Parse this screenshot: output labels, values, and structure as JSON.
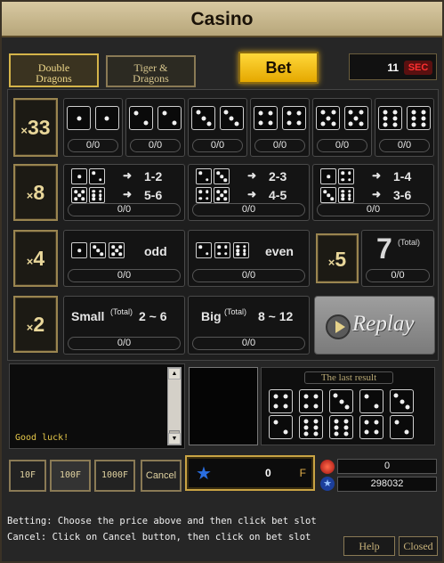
{
  "window": {
    "title": "Casino"
  },
  "tabs": [
    {
      "label": "Double Dragons",
      "active": true
    },
    {
      "label": "Tiger & Dragons",
      "active": false
    }
  ],
  "bet_button": "Bet",
  "counter": {
    "value": "11",
    "unit": "SEC"
  },
  "multipliers": [
    {
      "x": "×",
      "v": "33"
    },
    {
      "x": "×",
      "v": "8"
    },
    {
      "x": "×",
      "v": "4"
    },
    {
      "x": "×",
      "v": "2"
    },
    {
      "x": "×",
      "v": "5"
    }
  ],
  "doubles": [
    {
      "faces": [
        1,
        1
      ],
      "count": "0/0"
    },
    {
      "faces": [
        2,
        2
      ],
      "count": "0/0"
    },
    {
      "faces": [
        3,
        3
      ],
      "count": "0/0"
    },
    {
      "faces": [
        4,
        4
      ],
      "count": "0/0"
    },
    {
      "faces": [
        5,
        5
      ],
      "count": "0/0"
    },
    {
      "faces": [
        6,
        6
      ],
      "count": "0/0"
    }
  ],
  "pairs": [
    {
      "arrow": "➜",
      "a": "1-2",
      "b": "5-6",
      "count": "0/0"
    },
    {
      "arrow": "➜",
      "a": "2-3",
      "b": "4-5",
      "count": "0/0"
    },
    {
      "arrow": "➜",
      "a": "1-4",
      "b": "3-6",
      "count": "0/0"
    }
  ],
  "odd_even": [
    {
      "label": "odd",
      "faces": [
        1,
        3,
        5
      ],
      "count": "0/0"
    },
    {
      "label": "even",
      "faces": [
        2,
        4,
        6
      ],
      "count": "0/0"
    }
  ],
  "total7": {
    "value": "7",
    "tag": "(Total)",
    "count": "0/0"
  },
  "small_big": [
    {
      "label": "Small",
      "tag": "(Total)",
      "range": "2 ~ 6",
      "count": "0/0"
    },
    {
      "label": "Big",
      "tag": "(Total)",
      "range": "8 ~ 12",
      "count": "0/0"
    }
  ],
  "replay_label": "Replay",
  "chat": {
    "message": "Good luck!"
  },
  "last_result": {
    "title": "The last result",
    "top": [
      4,
      4,
      3,
      2,
      3
    ],
    "bottom": [
      2,
      6,
      6,
      4,
      2
    ]
  },
  "chips": [
    "10F",
    "100F",
    "1000F",
    "Cancel"
  ],
  "bet_amount": {
    "value": "0",
    "unit": "F"
  },
  "balances": {
    "red": "0",
    "blue": "298032"
  },
  "help": [
    "Betting: Choose the price above and then click bet slot",
    "Cancel: Click on Cancel button, then click on bet slot"
  ],
  "footer": {
    "help": "Help",
    "close": "Closed"
  },
  "colors": {
    "accent": "#d4b44a",
    "bet": "#f5c518",
    "bg": "#262626"
  }
}
